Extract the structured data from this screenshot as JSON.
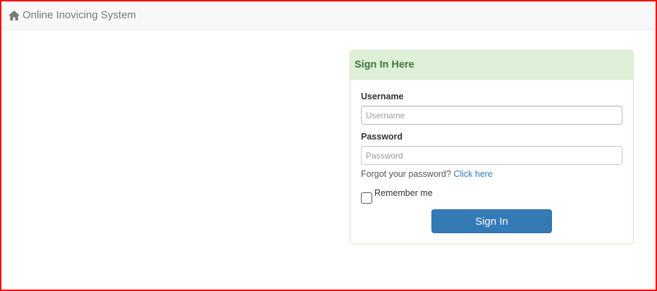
{
  "navbar": {
    "brand_text": "Online Inovicing System",
    "brand_icon": "home-icon"
  },
  "panel": {
    "title": "Sign In Here",
    "username": {
      "label": "Username",
      "placeholder": "Username",
      "value": ""
    },
    "password": {
      "label": "Password",
      "placeholder": "Password",
      "value": ""
    },
    "forgot_text": "Forgot your password?",
    "forgot_link": "Click here",
    "remember_label": "Remember me",
    "remember_checked": false,
    "submit_label": "Sign In"
  },
  "colors": {
    "frame": "#ff0000",
    "panel_heading_bg": "#dff0d8",
    "panel_title": "#3c763d",
    "button_bg": "#337ab7",
    "link": "#337ab7"
  }
}
